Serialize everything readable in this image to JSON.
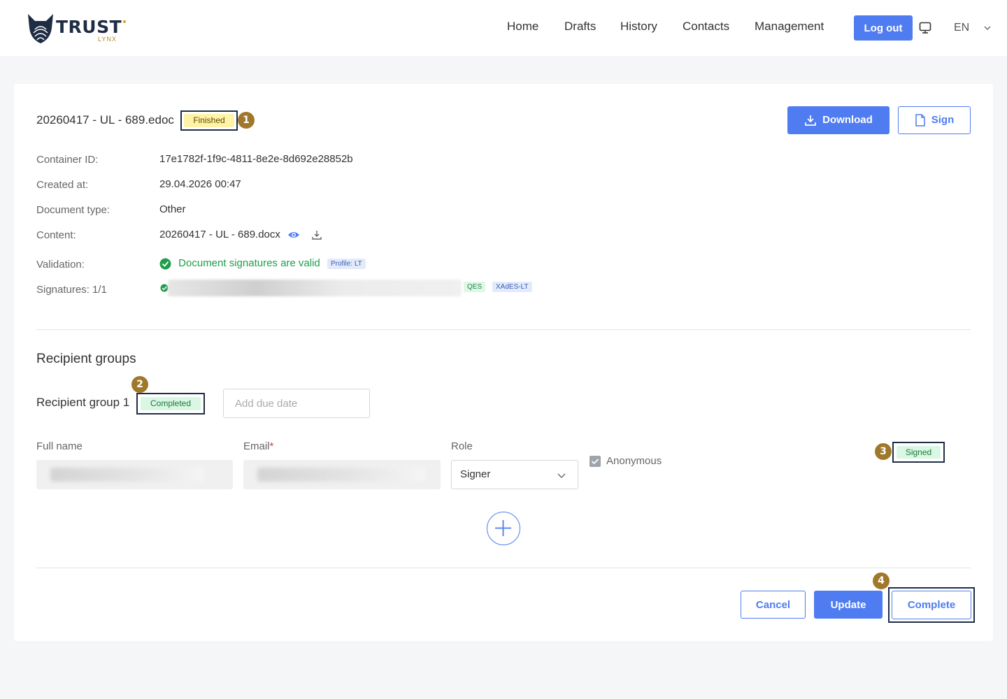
{
  "header": {
    "logo_text": "TRUST",
    "logo_sub": "LYNX",
    "nav": [
      "Home",
      "Drafts",
      "History",
      "Contacts",
      "Management"
    ],
    "logout_label": "Log out",
    "language": "EN"
  },
  "document": {
    "title": "20260417 - UL - 689.edoc",
    "status": "Finished",
    "download_label": "Download",
    "sign_label": "Sign",
    "fields": {
      "container_id_label": "Container ID:",
      "container_id": "17e1782f-1f9c-4811-8e2e-8d692e28852b",
      "created_label": "Created at:",
      "created": "29.04.2026 00:47",
      "doctype_label": "Document type:",
      "doctype": "Other",
      "content_label": "Content:",
      "content": "20260417 - UL - 689.docx",
      "validation_label": "Validation:",
      "validation": "Document signatures are valid",
      "validation_profile": "Profile: LT",
      "signatures_label": "Signatures: 1/1",
      "sig_tag_1": "QES",
      "sig_tag_2": "XAdES-LT"
    }
  },
  "recipients": {
    "section_title": "Recipient groups",
    "group_name": "Recipient group 1",
    "group_status": "Completed",
    "due_date_placeholder": "Add due date",
    "columns": {
      "full_name": "Full name",
      "email": "Email",
      "email_required": "*",
      "role": "Role"
    },
    "role_value": "Signer",
    "anonymous_label": "Anonymous",
    "anonymous_checked": true,
    "signer_status": "Signed"
  },
  "footer": {
    "cancel_label": "Cancel",
    "update_label": "Update",
    "complete_label": "Complete"
  },
  "markers": [
    "1",
    "2",
    "3",
    "4"
  ],
  "colors": {
    "accent": "#4f7cf0",
    "finished_badge": "#fff3a8",
    "completed_badge": "#d9f7e2",
    "valid": "#1e9e4a",
    "marker": "#a0782b"
  }
}
